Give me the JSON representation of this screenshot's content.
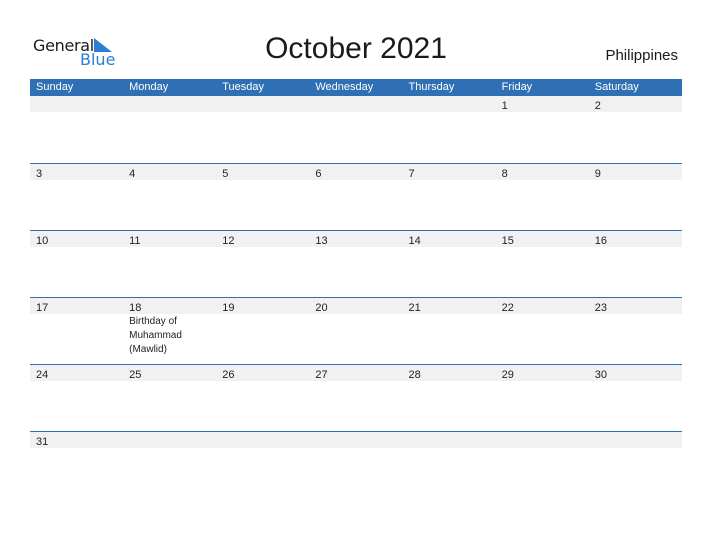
{
  "logo": {
    "general": "General",
    "blue": "Blue"
  },
  "header": {
    "title": "October 2021",
    "country": "Philippines"
  },
  "calendar": {
    "weekdays": [
      "Sunday",
      "Monday",
      "Tuesday",
      "Wednesday",
      "Thursday",
      "Friday",
      "Saturday"
    ],
    "weeks": [
      [
        "",
        "",
        "",
        "",
        "",
        "1",
        "2"
      ],
      [
        "3",
        "4",
        "5",
        "6",
        "7",
        "8",
        "9"
      ],
      [
        "10",
        "11",
        "12",
        "13",
        "14",
        "15",
        "16"
      ],
      [
        "17",
        "18",
        "19",
        "20",
        "21",
        "22",
        "23"
      ],
      [
        "24",
        "25",
        "26",
        "27",
        "28",
        "29",
        "30"
      ],
      [
        "31",
        "",
        "",
        "",
        "",
        "",
        ""
      ]
    ],
    "events": [
      {
        "week": 3,
        "day": 1,
        "label": "Birthday of Muhammad (Mawlid)"
      }
    ]
  },
  "colors": {
    "accent": "#2e70b3",
    "logo_blue": "#2a7fd4",
    "row_shade": "#f1f1f1"
  }
}
